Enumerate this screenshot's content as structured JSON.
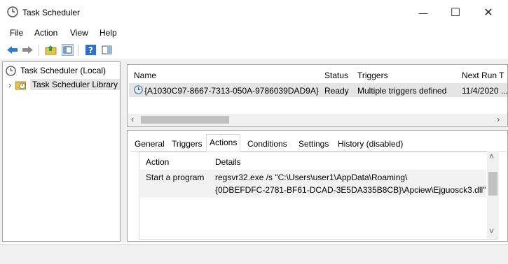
{
  "window": {
    "title": "Task Scheduler",
    "minimize": "—",
    "maximize": "☐",
    "close": "✕"
  },
  "menu": [
    "File",
    "Action",
    "View",
    "Help"
  ],
  "tree": {
    "root": "Task Scheduler (Local)",
    "library": "Task Scheduler Library",
    "expander": "›"
  },
  "task_list": {
    "columns": [
      "Name",
      "Status",
      "Triggers",
      "Next Run T"
    ],
    "rows": [
      {
        "name": "{A1030C97-8667-7313-050A-9786039DAD9A}",
        "status": "Ready",
        "triggers": "Multiple triggers defined",
        "next_run": "11/4/2020 ..."
      }
    ],
    "scroll_left": "‹",
    "scroll_right": "›"
  },
  "tabs": [
    "General",
    "Triggers",
    "Actions",
    "Conditions",
    "Settings",
    "History (disabled)"
  ],
  "active_tab": "Actions",
  "actions_table": {
    "columns": [
      "Action",
      "Details"
    ],
    "rows": [
      {
        "action": "Start a program",
        "details_line1": "regsvr32.exe /s \"C:\\Users\\user1\\AppData\\Roaming\\",
        "details_line2": "{0DBEFDFC-2781-BF61-DCAD-3E5DA335B8CB}\\Apciew\\Ejguosck3.dll\""
      }
    ],
    "scroll_up": "˄",
    "scroll_down": "˅"
  }
}
